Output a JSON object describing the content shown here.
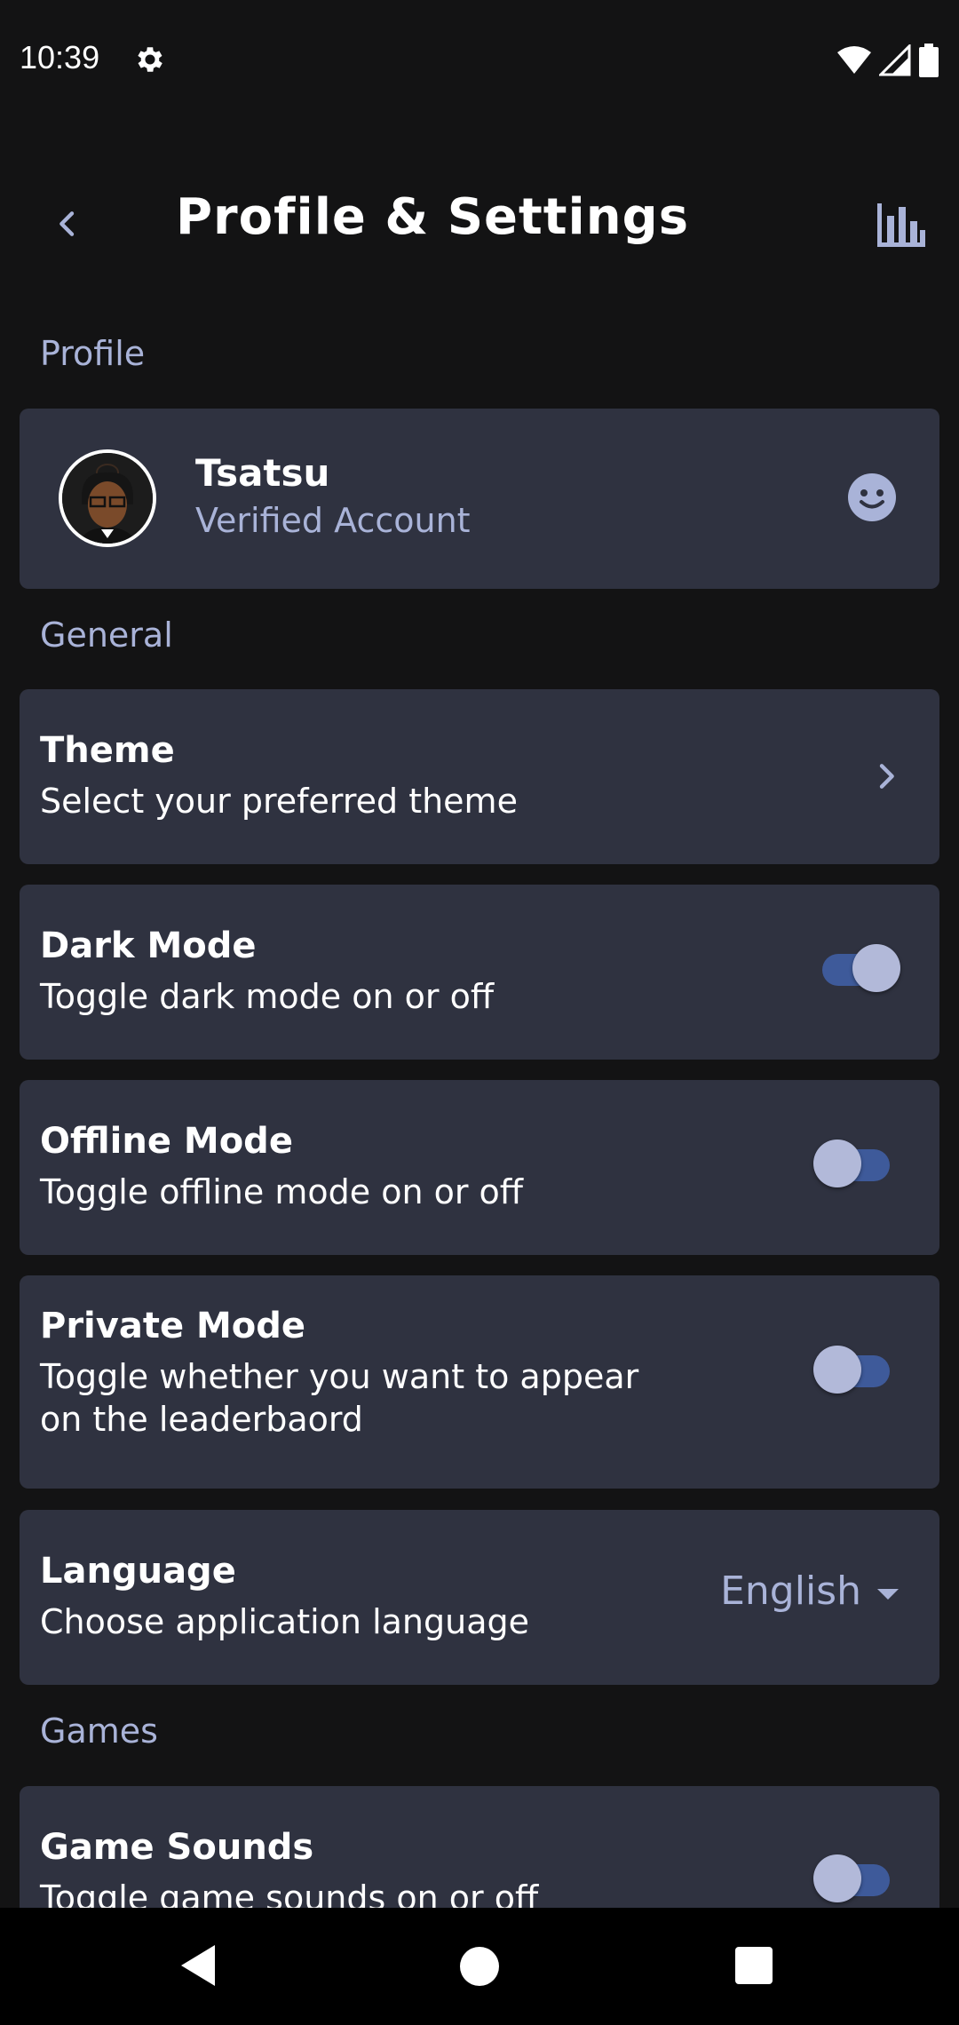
{
  "status_bar": {
    "time": "10:39"
  },
  "app_bar": {
    "title": "Profile & Settings"
  },
  "sections": {
    "profile": "Profile",
    "general": "General",
    "games": "Games"
  },
  "profile": {
    "name": "Tsatsu",
    "status": "Verified Account"
  },
  "settings": {
    "theme": {
      "title": "Theme",
      "subtitle": "Select your preferred theme"
    },
    "dark_mode": {
      "title": "Dark Mode",
      "subtitle": "Toggle dark mode on or off",
      "on": true
    },
    "offline_mode": {
      "title": "Offline Mode",
      "subtitle": "Toggle offline mode on or off",
      "on": false
    },
    "private_mode": {
      "title": "Private Mode",
      "subtitle_line1": "Toggle whether you want to appear",
      "subtitle_line2": "on the leaderbaord",
      "on": false
    },
    "language": {
      "title": "Language",
      "subtitle": "Choose application language",
      "value": "English"
    },
    "game_sounds": {
      "title": "Game Sounds",
      "subtitle": "Toggle game sounds on or off",
      "on": false
    }
  },
  "colors": {
    "background": "#131314",
    "card": "#2f3240",
    "accent": "#a9b3d8",
    "toggle_track": "#3e5a9a",
    "toggle_knob": "#b2b9d9"
  },
  "icons": [
    "settings-gear-icon",
    "wifi-icon",
    "cellular-signal-icon",
    "battery-icon",
    "back-arrow-icon",
    "bar-chart-icon",
    "smiley-face-icon",
    "chevron-right-icon",
    "dropdown-caret-icon"
  ]
}
